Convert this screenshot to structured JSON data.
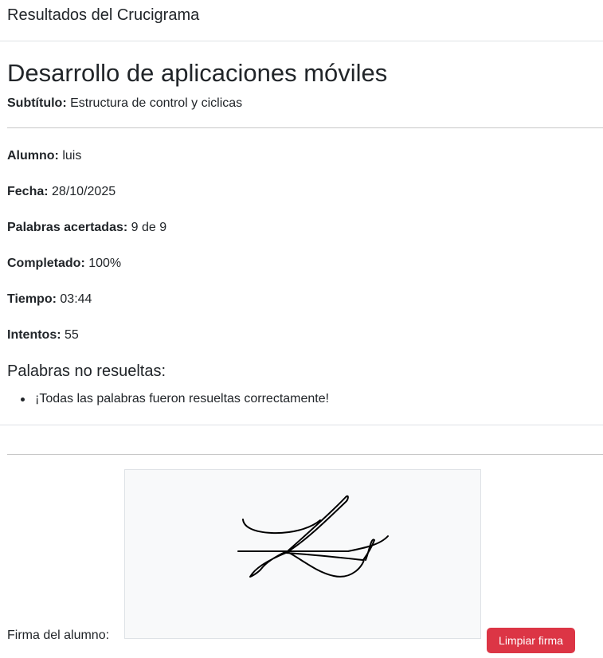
{
  "header": {
    "title": "Resultados del Crucigrama"
  },
  "course": {
    "title": "Desarrollo de aplicaciones móviles",
    "subtitle_label": "Subtítulo:",
    "subtitle_value": "Estructura de control y ciclicas"
  },
  "results": {
    "student_label": "Alumno:",
    "student_value": "luis",
    "date_label": "Fecha:",
    "date_value": "28/10/2025",
    "words_label": "Palabras acertadas:",
    "words_value": "9 de 9",
    "completed_label": "Completado:",
    "completed_value": "100%",
    "time_label": "Tiempo:",
    "time_value": "03:44",
    "attempts_label": "Intentos:",
    "attempts_value": "55"
  },
  "unsolved": {
    "title": "Palabras no resueltas:",
    "items": [
      "¡Todas las palabras fueron resueltas correctamente!"
    ]
  },
  "signature": {
    "label": "Firma del alumno:",
    "clear_button": "Limpiar firma",
    "stroke_color": "#000000"
  },
  "colors": {
    "danger": "#dc3545",
    "canvas_bg": "#f8f9fa",
    "text": "#212529"
  }
}
